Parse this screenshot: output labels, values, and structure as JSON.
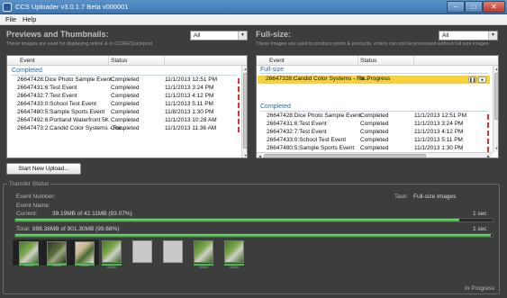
{
  "window": {
    "title": "CCS Uploader v3.0.1.7 Beta v000001"
  },
  "menu": [
    "File",
    "Help"
  ],
  "left_panel": {
    "heading": "Previews and Thumbnails:",
    "subtitle": "These images are used for displaying online & in CORE/Quickpost",
    "filter": "All",
    "columns": [
      "Event",
      "Status"
    ],
    "group": "Completed",
    "rows": [
      {
        "event": "26647428:Dice Photo Sample Event",
        "status": "Completed",
        "time": "11/1/2013 12:51 PM"
      },
      {
        "event": "26647431:6:Test Event",
        "status": "Completed",
        "time": "11/1/2013 3:24 PM"
      },
      {
        "event": "26647432:7:Test Event",
        "status": "Completed",
        "time": "11/1/2013 4:12 PM"
      },
      {
        "event": "26647433:0:School Test Event",
        "status": "Completed",
        "time": "11/1/2013 5:11 PM"
      },
      {
        "event": "26647480:5:Sample Sports Event",
        "status": "Completed",
        "time": "11/8/2013 1:30 PM"
      },
      {
        "event": "26647492:6:Portland Waterfront 5K",
        "status": "Completed",
        "time": "11/1/2013 10:28 AM"
      },
      {
        "event": "26647473:2:Candid Color Systems - Ra...",
        "status": "Completed",
        "time": "11/1/2013 11:36 AM"
      }
    ]
  },
  "right_panel": {
    "heading": "Full-size:",
    "subtitle": "These images are used to produce prints & products, orders can not be processed without full size images",
    "filter": "All",
    "columns": [
      "Event",
      "Status"
    ],
    "group_active": "Full-size",
    "active_row": {
      "event": "26647328:Candid Color Systems - Ra...",
      "status": "In Progress"
    },
    "group_done": "Completed",
    "rows": [
      {
        "event": "26647428:Dice Photo Sample Event",
        "status": "Completed",
        "time": "11/1/2013 12:51 PM"
      },
      {
        "event": "26647431:6:Test Event",
        "status": "Completed",
        "time": "11/1/2013 3:24 PM"
      },
      {
        "event": "26647432:7:Test Event",
        "status": "Completed",
        "time": "11/1/2013 4:12 PM"
      },
      {
        "event": "26647433:0:School Test Event",
        "status": "Completed",
        "time": "11/1/2013 5:11 PM"
      },
      {
        "event": "26647480:5:Sample Sports Event",
        "status": "Completed",
        "time": "11/1/2013 1:30 PM"
      }
    ]
  },
  "actions": {
    "start_upload": "Start New Upload..."
  },
  "transfer": {
    "legend": "Transfer Status",
    "event_number_label": "Event Number:",
    "event_name_label": "Event Name:",
    "current_label": "Current:",
    "current_value": "39.19MB of 42.11MB (93.07%)",
    "current_fraction": 0.9307,
    "current_time": "1 sec",
    "total_label": "Total:",
    "total_value": "898.38MB of 901.30MB (99.68%)",
    "total_fraction": 0.9968,
    "total_time": "1 sec",
    "task_label": "Task:",
    "task_value": "Full-size Images",
    "status": "In Progress"
  },
  "thumbnails": [
    {
      "kind": "photo",
      "caption": "00000",
      "done": true,
      "framed": true
    },
    {
      "kind": "dark",
      "caption": "00000",
      "done": true,
      "framed": true
    },
    {
      "kind": "lite",
      "caption": "00000",
      "done": true,
      "framed": true
    },
    {
      "kind": "photo",
      "caption": "00000",
      "done": true,
      "framed": false
    },
    {
      "kind": "blank",
      "caption": "",
      "done": false,
      "framed": false
    },
    {
      "kind": "blank",
      "caption": "",
      "done": false,
      "framed": false
    },
    {
      "kind": "photo",
      "caption": "00000",
      "done": true,
      "framed": false
    },
    {
      "kind": "photo",
      "caption": "00000",
      "done": true,
      "framed": false
    }
  ]
}
